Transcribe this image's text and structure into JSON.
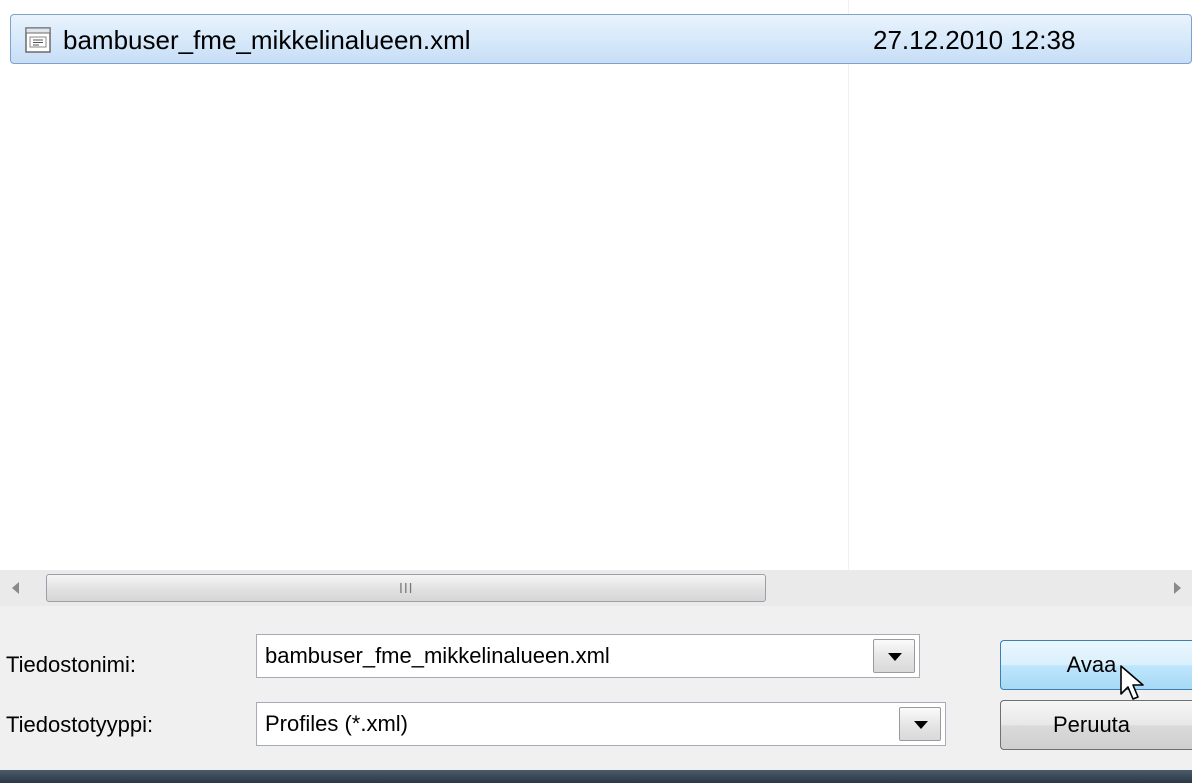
{
  "file_list": {
    "rows": [
      {
        "name": "bambuser_fme_mikkelinalueen.xml",
        "date": "27.12.2010 12:38",
        "icon": "xml-file-icon",
        "selected": true
      }
    ]
  },
  "scrollbar": {
    "grip": "III"
  },
  "form": {
    "filename_label": "Tiedostonimi:",
    "filename_value": "bambuser_fme_mikkelinalueen.xml",
    "filetype_label": "Tiedostotyyppi:",
    "filetype_value": "Profiles (*.xml)"
  },
  "buttons": {
    "open_label": "Avaa",
    "cancel_label": "Peruuta"
  },
  "colors": {
    "selection_border": "#7da2ce",
    "selection_fill": "#d6e8fa",
    "dialog_background": "#f0f0f0"
  }
}
